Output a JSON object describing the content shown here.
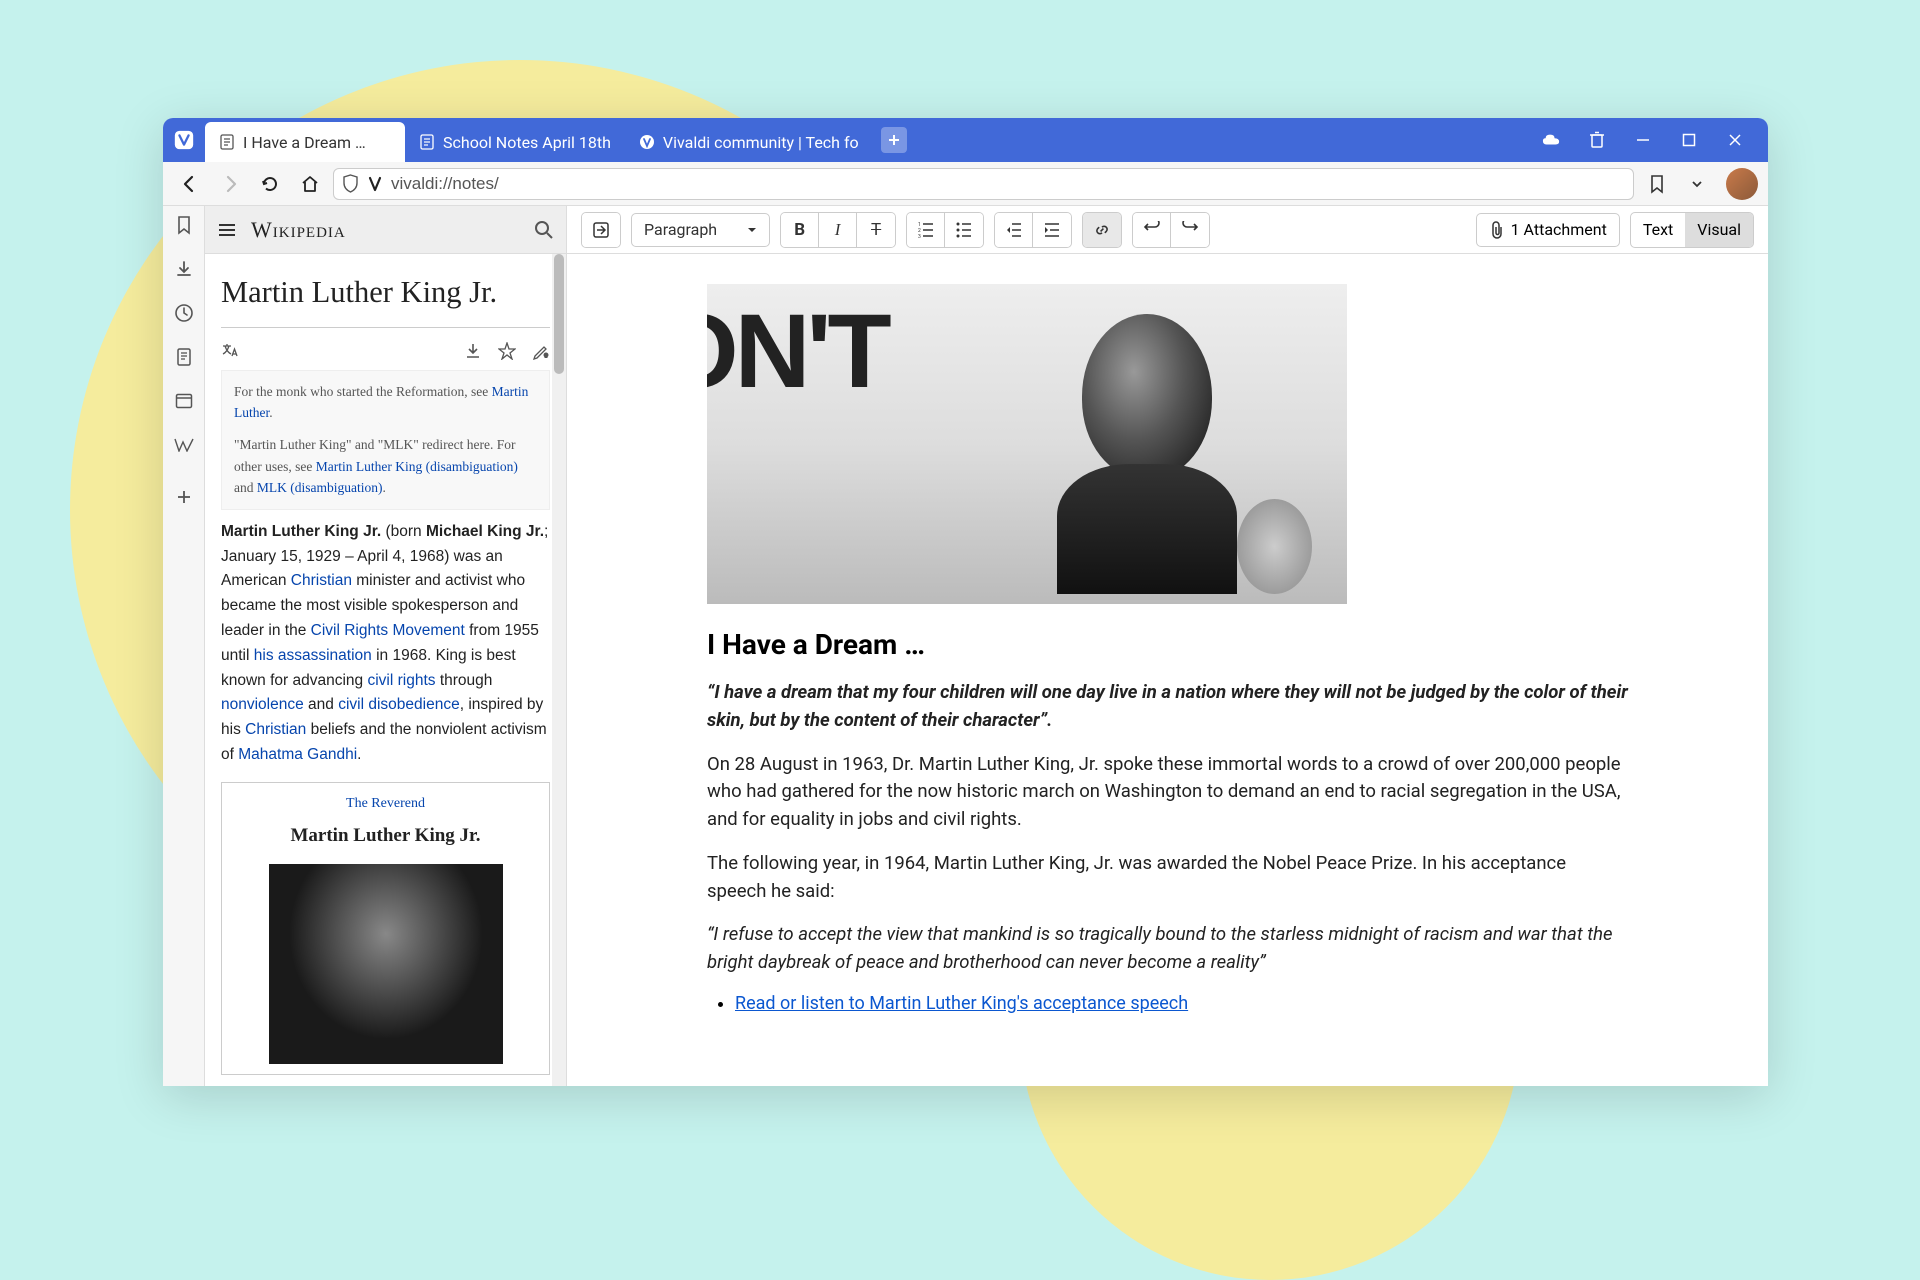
{
  "tabs": [
    {
      "label": "I Have a Dream …",
      "active": true,
      "icon": "note-icon"
    },
    {
      "label": "School Notes April 18th",
      "active": false,
      "icon": "note-icon"
    },
    {
      "label": "Vivaldi community | Tech fo",
      "active": false,
      "icon": "vivaldi-round-icon"
    }
  ],
  "url": "vivaldi://notes/",
  "toolbar": {
    "paragraph_label": "Paragraph",
    "attachment_label": "1 Attachment",
    "view_text": "Text",
    "view_visual": "Visual"
  },
  "wiki": {
    "brand": "Wikipedia",
    "title": "Martin Luther King Jr.",
    "hatnote1_prefix": "For the monk who started the Reformation, see ",
    "hatnote1_link": "Martin Luther",
    "hatnote2_part1": "\"Martin Luther King\" and \"MLK\" redirect here. For other uses, see ",
    "hatnote2_link1": "Martin Luther King (disambiguation)",
    "hatnote2_mid": " and ",
    "hatnote2_link2": "MLK (disambiguation)",
    "para": {
      "b1": "Martin Luther King Jr.",
      "t1": " (born ",
      "b2": "Michael King Jr.",
      "t2": "; January 15, 1929 – April 4, 1968) was an American ",
      "l1": "Christian",
      "t3": " minister and activist who became the most visible spokesperson and leader in the ",
      "l2": "Civil Rights Movement",
      "t4": " from 1955 until ",
      "l3": "his assassination",
      "t5": " in 1968. King is best known for advancing ",
      "l4": "civil rights",
      "t6": " through ",
      "l5": "nonviolence",
      "t7": " and ",
      "l6": "civil disobedience",
      "t8": ", inspired by his ",
      "l7": "Christian",
      "t9": " beliefs and the nonviolent activism of ",
      "l8": "Mahatma Gandhi",
      "t10": "."
    },
    "infobox_sub": "The Reverend",
    "infobox_name": "Martin Luther King Jr."
  },
  "note": {
    "hero_text": "ON'T",
    "title": "I Have a Dream …",
    "quote1": "“I have a dream that my four children will one day live in a nation where they will not be judged by the color of their skin, but by the content of their character”.",
    "para1": "On 28 August in 1963, Dr. Martin Luther King, Jr. spoke these immortal words to a crowd of over 200,000 people who had gathered for the now historic march on Washington to demand an end to racial segregation in the USA, and for equality in jobs and civil rights.",
    "para2": "The following year, in 1964, Martin Luther King, Jr. was awarded the Nobel Peace Prize. In his acceptance speech he said:",
    "quote2": "“I refuse to accept the view that mankind is so tragically bound to the starless midnight of racism and war that the bright daybreak of peace and brotherhood can never become a reality”",
    "link1": "Read or listen to Martin Luther King's acceptance speech"
  }
}
